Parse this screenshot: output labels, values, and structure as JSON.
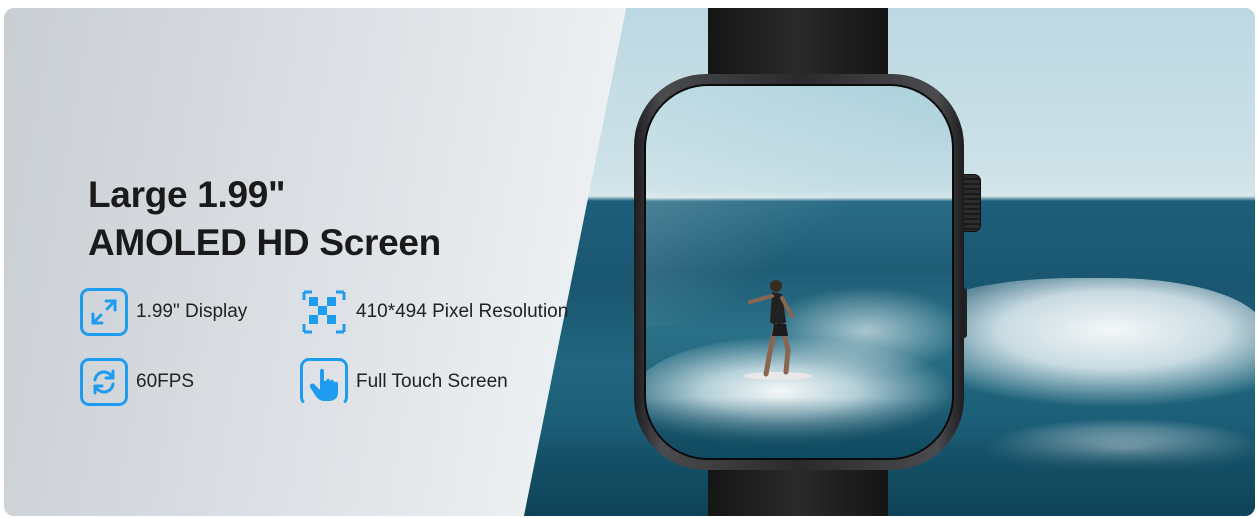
{
  "headline": {
    "line1": "Large 1.99\"",
    "line2": "AMOLED HD Screen"
  },
  "features": [
    {
      "label": "1.99\" Display",
      "icon": "expand-arrows-icon"
    },
    {
      "label": "410*494 Pixel Resolution",
      "icon": "pixel-grid-icon"
    },
    {
      "label": "60FPS",
      "icon": "refresh-cycle-icon"
    },
    {
      "label": "Full Touch Screen",
      "icon": "touch-hand-icon"
    }
  ],
  "colors": {
    "accent": "#1e9cf0",
    "text": "#1a1a1a"
  }
}
